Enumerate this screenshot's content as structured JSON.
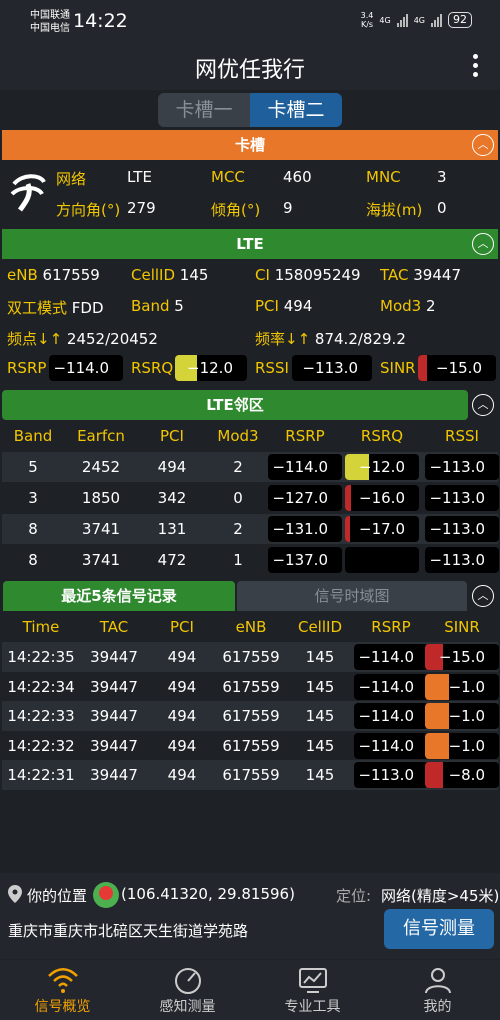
{
  "status": {
    "carrier1": "中国联通",
    "carrier2": "中国电信",
    "time": "14:22",
    "speed": "3.4",
    "speed_unit": "K/s",
    "net1": "4G",
    "net2": "4G",
    "battery": "92"
  },
  "header": {
    "title": "网优任我行",
    "slot1": "卡槽一",
    "slot2": "卡槽二"
  },
  "sim": {
    "section": "卡槽",
    "network_label": "网络",
    "network": "LTE",
    "mcc_label": "MCC",
    "mcc": "460",
    "mnc_label": "MNC",
    "mnc": "3",
    "azimuth_label": "方向角(°)",
    "azimuth": "279",
    "tilt_label": "倾角(°)",
    "tilt": "9",
    "altitude_label": "海拔(m)",
    "altitude": "0"
  },
  "lte": {
    "section": "LTE",
    "enb_label": "eNB",
    "enb": "617559",
    "cellid_label": "CellID",
    "cellid": "145",
    "ci_label": "CI",
    "ci": "158095249",
    "tac_label": "TAC",
    "tac": "39447",
    "duplex_label": "双工模式",
    "duplex": "FDD",
    "band_label": "Band",
    "band": "5",
    "pci_label": "PCI",
    "pci": "494",
    "mod3_label": "Mod3",
    "mod3": "2",
    "freq_label": "频点↓↑",
    "freq": "2452/20452",
    "rate_label": "频率↓↑",
    "rate": "874.2/829.2",
    "rsrp_label": "RSRP",
    "rsrp": "−114.0",
    "rsrq_label": "RSRQ",
    "rsrq": "−12.0",
    "rsrq_level": 0.3,
    "rssi_label": "RSSI",
    "rssi": "−113.0",
    "sinr_label": "SINR",
    "sinr": "−15.0",
    "sinr_level": 0.12
  },
  "neighbor": {
    "section": "LTE邻区",
    "headers": [
      "Band",
      "Earfcn",
      "PCI",
      "Mod3",
      "RSRP",
      "RSRQ",
      "RSSI"
    ],
    "rows": [
      [
        "5",
        "2452",
        "494",
        "2",
        "−114.0",
        "−12.0",
        "−113.0"
      ],
      [
        "3",
        "1850",
        "342",
        "0",
        "−127.0",
        "−16.0",
        "−113.0"
      ],
      [
        "8",
        "3741",
        "131",
        "2",
        "−131.0",
        "−17.0",
        "−113.0"
      ],
      [
        "8",
        "3741",
        "472",
        "1",
        "−137.0",
        "",
        "−113.0"
      ]
    ]
  },
  "history": {
    "tab1": "最近5条信号记录",
    "tab2": "信号时域图",
    "headers": [
      "Time",
      "TAC",
      "PCI",
      "eNB",
      "CellID",
      "RSRP",
      "SINR"
    ],
    "rows": [
      [
        "14:22:35",
        "39447",
        "494",
        "617559",
        "145",
        "−114.0",
        "−15.0"
      ],
      [
        "14:22:34",
        "39447",
        "494",
        "617559",
        "145",
        "−114.0",
        "−1.0"
      ],
      [
        "14:22:33",
        "39447",
        "494",
        "617559",
        "145",
        "−114.0",
        "−1.0"
      ],
      [
        "14:22:32",
        "39447",
        "494",
        "617559",
        "145",
        "−114.0",
        "−1.0"
      ],
      [
        "14:22:31",
        "39447",
        "494",
        "617559",
        "145",
        "−113.0",
        "−8.0"
      ]
    ]
  },
  "location": {
    "label": "你的位置",
    "coords": "(106.41320, 29.81596)",
    "mode_label": "定位:",
    "mode": "网络(精度>45米)",
    "address": "重庆市重庆市北碚区天生街道学苑路",
    "measure_button": "信号测量"
  },
  "nav": {
    "items": [
      "信号概览",
      "感知测量",
      "专业工具",
      "我的"
    ]
  }
}
